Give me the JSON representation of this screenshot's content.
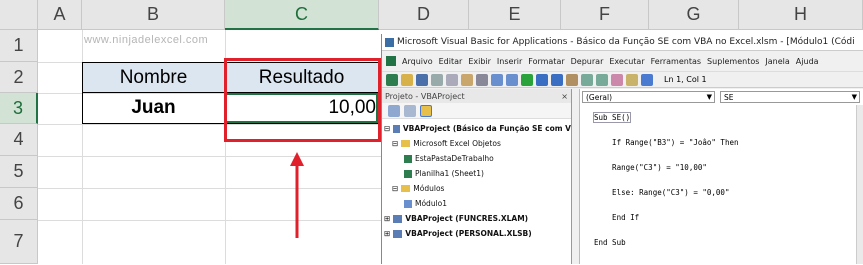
{
  "excel": {
    "columns": [
      "A",
      "B",
      "C",
      "D",
      "E",
      "F",
      "G",
      "H"
    ],
    "rows": [
      "1",
      "2",
      "3",
      "4",
      "5",
      "6",
      "7"
    ],
    "watermark": "www.ninjadelexcel.com",
    "b2": "Nombre",
    "c2": "Resultado",
    "b3": "Juan",
    "c3": "10,00"
  },
  "vbe": {
    "title": "Microsoft Visual Basic for Applications - Básico da Função SE com VBA no Excel.xlsm - [Módulo1 (Códi",
    "menu": [
      "Arquivo",
      "Editar",
      "Exibir",
      "Inserir",
      "Formatar",
      "Depurar",
      "Executar",
      "Ferramentas",
      "Suplementos",
      "Janela",
      "Ajuda"
    ],
    "position": "Ln 1, Col 1",
    "project_header": "Projeto - VBAProject",
    "project_close": "×",
    "tree": [
      "VBAProject (Básico da Função SE com V",
      "Microsoft Excel Objetos",
      "EstaPastaDeTrabalho",
      "Planilha1 (Sheet1)",
      "Módulos",
      "Módulo1",
      "VBAProject (FUNCRES.XLAM)",
      "VBAProject (PERSONAL.XLSB)"
    ],
    "combo_left": "(Geral)",
    "combo_right": "SE",
    "code": [
      "Sub SE()",
      "    If Range(\"B3\") = \"Joâo\" Then",
      "    Range(\"C3\") = \"10,00\"",
      "    Else: Range(\"C3\") = \"0,00\"",
      "    End If",
      "End Sub"
    ]
  },
  "colors": {
    "header_fill": "#dce6f1",
    "highlight": "#e0202a",
    "accent": "#217346"
  }
}
